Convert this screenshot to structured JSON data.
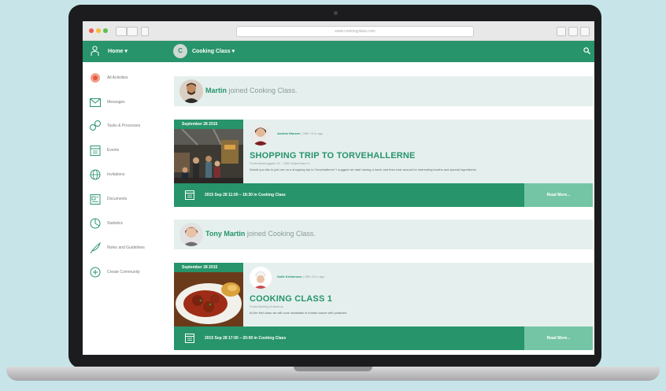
{
  "browser": {
    "url": "www.cookingclass.com",
    "colors": {
      "close": "#ee5b4f",
      "minimize": "#f4bd3c",
      "maximize": "#5dc04d"
    }
  },
  "header": {
    "home_label": "Home ▾",
    "group_avatar_letter": "C",
    "group_label": "Cooking Class ▾",
    "search_icon": "search-icon",
    "color": "#27946b"
  },
  "sidebar": {
    "items": [
      {
        "label": "All Activities",
        "icon": "activities-icon"
      },
      {
        "label": "Messages",
        "icon": "envelope-icon"
      },
      {
        "label": "Tasks & Processes",
        "icon": "tasks-icon"
      },
      {
        "label": "Events",
        "icon": "calendar-icon"
      },
      {
        "label": "Invitations",
        "icon": "globe-icon"
      },
      {
        "label": "Documents",
        "icon": "documents-icon"
      },
      {
        "label": "Statistics",
        "icon": "pie-chart-icon"
      },
      {
        "label": "Notes and Guidelines",
        "icon": "feather-icon"
      },
      {
        "label": "Create Community",
        "icon": "plus-circle-icon"
      }
    ]
  },
  "feed": {
    "activity_1": {
      "name": "Martin",
      "text": " joined Cooking Class."
    },
    "event_1": {
      "date": "September 28 2015",
      "author": "Andrea Hansen",
      "author_meta": " | 25th 10 m ago",
      "title": "SHOPPING TRIP TO TORVEHALLERNE",
      "subtitle": "Frederiksborggade 21 · 1360 København K",
      "description": "Would you like to join me on a shopping trip to Torvehallerne? I suggest we start having a lunch and then look around for interesting booths and special ingredients.",
      "time_text": "2015 Sep 28 11:00 – 18:30 in Cooking Class",
      "read_more": "Read More..."
    },
    "activity_2": {
      "name": "Tony Martin",
      "text": " joined Cooking Class."
    },
    "event_2": {
      "date": "September 28 2015",
      "author": "Sofie Kristensen",
      "author_meta": " | 25th 10 m ago",
      "title": "COOKING CLASS 1",
      "subtitle": "Frederiksberg Kulturhus",
      "description": "At the first class we will cook meatballs in tomato sauce with potatoes.",
      "time_text": "2015 Sep 28 17:00 – 20:00 in Cooking Class",
      "read_more": "Read More..."
    }
  }
}
